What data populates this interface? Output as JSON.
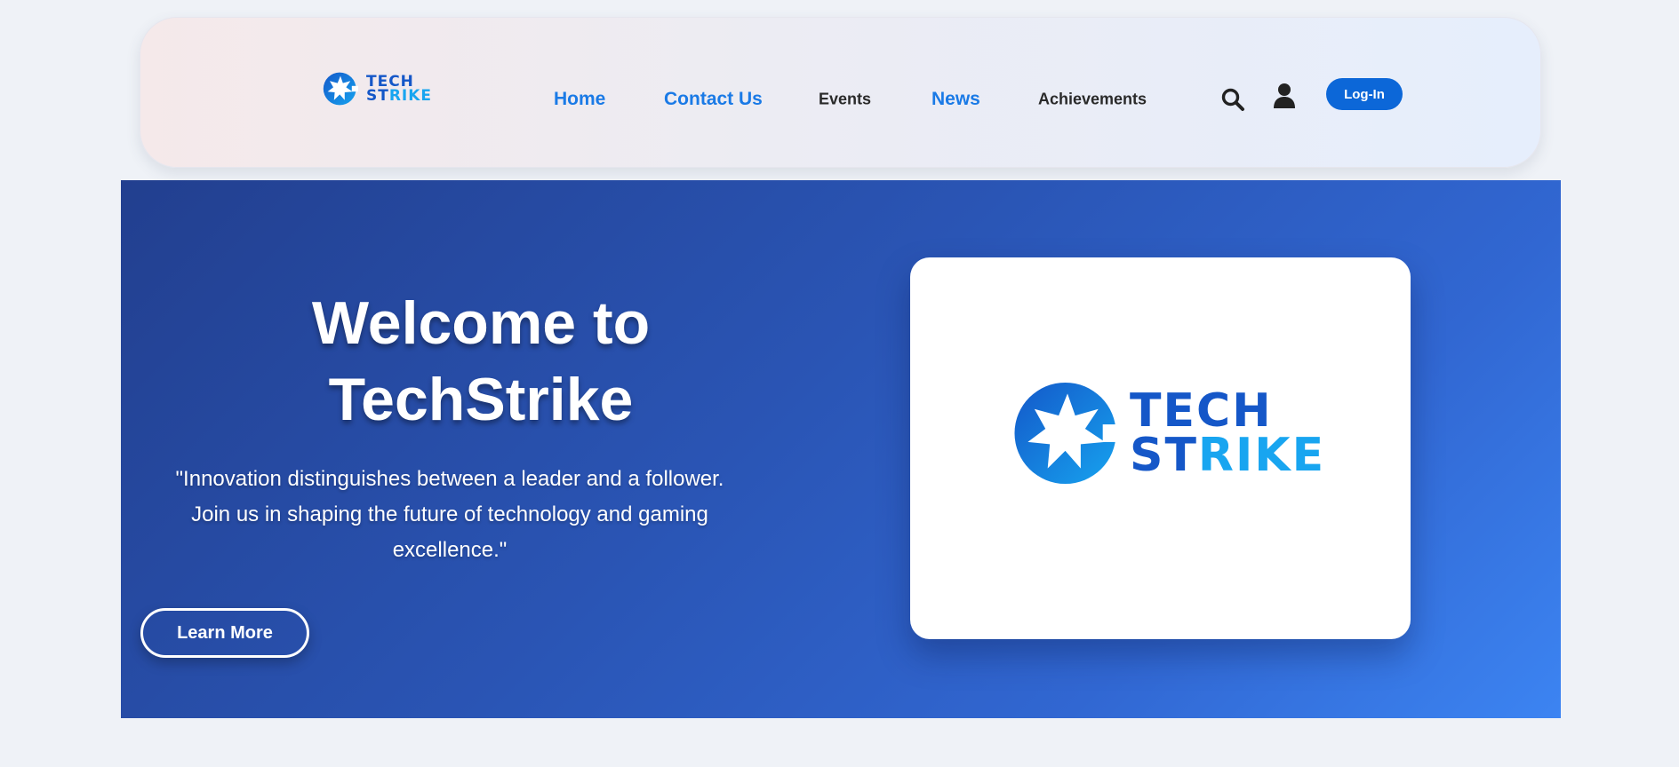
{
  "brand": {
    "line1": "TECH",
    "line2_main": "ST",
    "line2_accent": "RIKE",
    "primary_color": "#1557c8",
    "accent_color": "#18a5f0"
  },
  "nav": {
    "links": [
      {
        "label": "Home",
        "style": "blue"
      },
      {
        "label": "Contact Us",
        "style": "blue"
      },
      {
        "label": "Events",
        "style": "dark"
      },
      {
        "label": "News",
        "style": "blue"
      },
      {
        "label": "Achievements",
        "style": "dark"
      }
    ],
    "icons": [
      "search-icon",
      "user-icon"
    ],
    "login_label": "Log-In",
    "login_color": "#0c67d8"
  },
  "hero": {
    "title_line1": "Welcome to",
    "title_line2": "TechStrike",
    "quote_line1": "\"Innovation distinguishes between a leader and a follower.",
    "quote_line2": "Join us in shaping the future of technology and gaming",
    "quote_line3": "excellence.\"",
    "cta_label": "Learn More",
    "gradient_start": "#223f8f",
    "gradient_end": "#3c84f2"
  }
}
